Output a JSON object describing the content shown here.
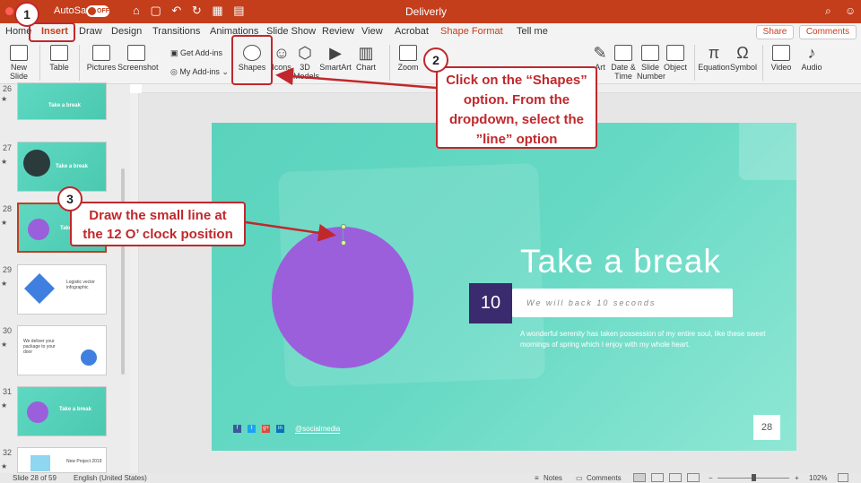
{
  "titlebar": {
    "autosave_label": "AutoSave",
    "autosave_state": "OFF",
    "document_title": "Deliverly",
    "qat_glyphs": "⌂ ▢ ↶ ↻ ▦ ▤"
  },
  "tabs": [
    "Home",
    "Insert",
    "Draw",
    "Design",
    "Transitions",
    "Animations",
    "Slide Show",
    "Review",
    "View",
    "Acrobat",
    "Shape Format",
    "Tell me"
  ],
  "active_tab": "Insert",
  "header_buttons": {
    "share": "Share",
    "comments": "Comments"
  },
  "ribbon": {
    "new_slide": "New Slide",
    "table": "Table",
    "pictures": "Pictures",
    "screenshot": "Screenshot",
    "get_addins": "Get Add-ins",
    "my_addins": "My Add-ins",
    "shapes": "Shapes",
    "icons": "Icons",
    "models_3d": "3D Models",
    "smartart": "SmartArt",
    "chart": "Chart",
    "zoom": "Zoom",
    "wordart": "Art",
    "date_time": "Date & Time",
    "slide_number": "Slide Number",
    "object": "Object",
    "equation": "Equation",
    "symbol": "Symbol",
    "video": "Video",
    "audio": "Audio"
  },
  "thumbnails": [
    {
      "num": "26",
      "title": "Take a break"
    },
    {
      "num": "27",
      "title": "Take a break"
    },
    {
      "num": "28",
      "title": "Take a break"
    },
    {
      "num": "29",
      "title": "Logistic vector infographic"
    },
    {
      "num": "30",
      "title": "We deliver your package to your door"
    },
    {
      "num": "31",
      "title": "Take a break"
    },
    {
      "num": "32",
      "title": "New Project 2019"
    }
  ],
  "slide": {
    "title": "Take a break",
    "badge_number": "10",
    "subtitle": "We will back 10 seconds",
    "body": "A wonderful serenity has taken possession of my entire soul, like these sweet mornings of spring which I enjoy with my whole heart.",
    "social_icons": [
      "f",
      "t",
      "g+",
      "in"
    ],
    "handle": "@socialmedia",
    "page_number": "28"
  },
  "callouts": {
    "step1_num": "1",
    "step2_num": "2",
    "step2_text": "Click on the “Shapes” option. From the dropdown, select the ”line” option",
    "step3_num": "3",
    "step3_text": "Draw the small line at the 12 O’ clock position"
  },
  "statusbar": {
    "slide_info": "Slide 28 of 59",
    "language": "English (United States)",
    "notes": "Notes",
    "comments": "Comments",
    "zoom": "102%"
  },
  "colors": {
    "accent": "#c43e1c",
    "callout": "#c0282c",
    "slide_teal": "#5ad3bd",
    "circle_purple": "#9b5fdc",
    "badge_dark": "#3a2a6e"
  }
}
